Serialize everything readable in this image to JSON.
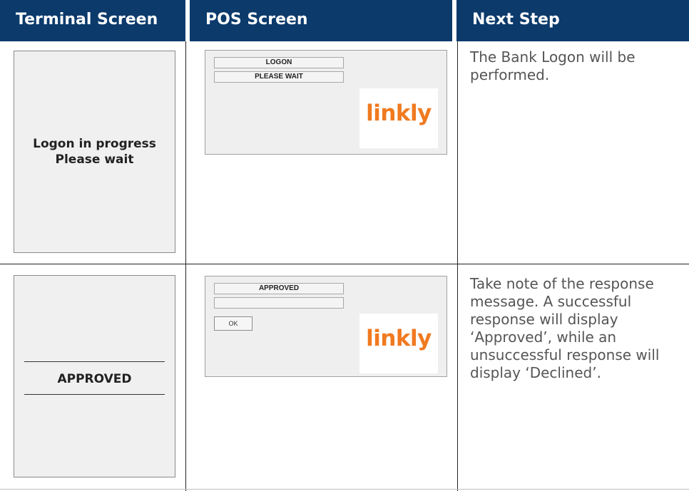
{
  "header": {
    "col1": "Terminal Screen",
    "col2": "POS Screen",
    "col3": "Next Step"
  },
  "colors": {
    "header_bg": "#0b3a6b",
    "logo_orange": "#f07a20"
  },
  "rows": [
    {
      "terminal": {
        "line1": "Logon in progress",
        "line2": "Please wait"
      },
      "pos": {
        "field1": "LOGON",
        "field2": "PLEASE WAIT",
        "logo": "linkly"
      },
      "next_step": "The Bank Logon will be performed."
    },
    {
      "terminal": {
        "line1": "APPROVED"
      },
      "pos": {
        "field1": "APPROVED",
        "field2": "",
        "button": "OK",
        "logo": "linkly"
      },
      "next_step": "Take note of the response message. A successful response will display ‘Approved’, while an unsuccessful response will display ‘Declined’."
    }
  ]
}
